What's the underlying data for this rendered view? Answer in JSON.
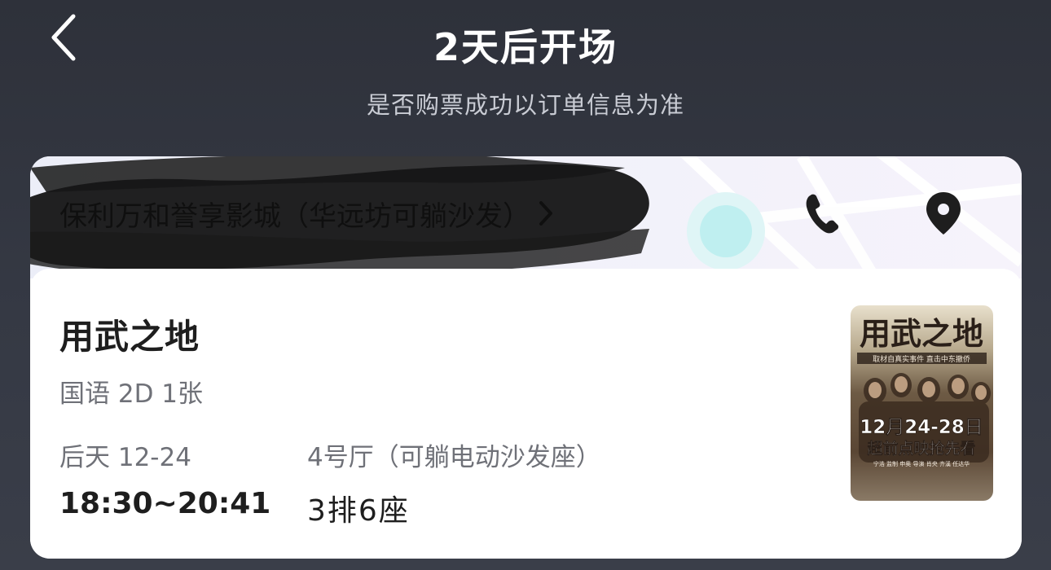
{
  "header": {
    "title": "2天后开场",
    "subtitle": "是否购票成功以订单信息为准"
  },
  "cinema": {
    "name": "保利万和誉享影城（华远坊可躺沙发）"
  },
  "movie": {
    "title": "用武之地",
    "meta": "国语 2D 1张",
    "show_day": "后天 12-24",
    "show_time": "18:30~20:41",
    "hall": "4号厅（可躺电动沙发座）",
    "seat": "3排6座"
  },
  "poster": {
    "title_text": "用武之地",
    "tagline": "取材自真实事件 直击中东撤侨",
    "date_line": "12月24-28日",
    "promo_line": "超前点映抢先看",
    "credits": "宁浩 监制 申奥 导演 肖央 齐溪 任达华"
  },
  "colors": {
    "background": "#2e313a",
    "card": "#ffffff",
    "text_primary": "#1e1e1e",
    "text_secondary": "#6f7178",
    "map_accent": "#bfeff0"
  },
  "icons": {
    "back": "chevron-left-icon",
    "cinema_arrow": "chevron-right-icon",
    "phone": "phone-icon",
    "location": "location-pin-icon"
  }
}
